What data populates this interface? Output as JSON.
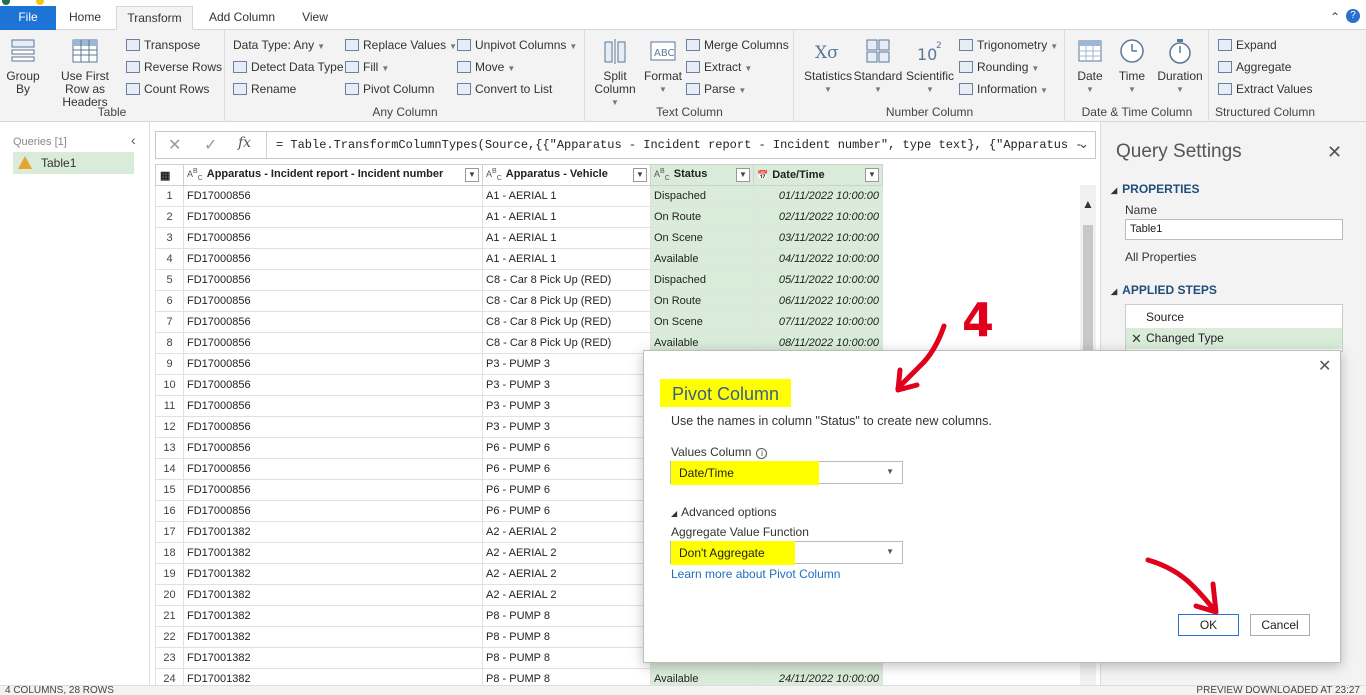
{
  "tabs": {
    "file": "File",
    "home": "Home",
    "transform": "Transform",
    "add_column": "Add Column",
    "view": "View"
  },
  "ribbon": {
    "table": {
      "label": "Table",
      "group_by": "Group By",
      "use_first_row": "Use First Row as Headers",
      "transpose": "Transpose",
      "reverse_rows": "Reverse Rows",
      "count_rows": "Count Rows"
    },
    "any_column": {
      "label": "Any Column",
      "data_type": "Data Type: Any",
      "detect_data_type": "Detect Data Type",
      "rename": "Rename",
      "replace_values": "Replace Values",
      "fill": "Fill",
      "pivot_column": "Pivot Column",
      "unpivot_columns": "Unpivot Columns",
      "move": "Move",
      "convert_to_list": "Convert to List"
    },
    "text_column": {
      "label": "Text Column",
      "split_column": "Split Column",
      "format": "Format",
      "merge_columns": "Merge Columns",
      "extract": "Extract",
      "parse": "Parse"
    },
    "number_column": {
      "label": "Number Column",
      "statistics": "Statistics",
      "standard": "Standard",
      "scientific": "Scientific",
      "trigonometry": "Trigonometry",
      "rounding": "Rounding",
      "information": "Information"
    },
    "date_time_column": {
      "label": "Date & Time Column",
      "date": "Date",
      "time": "Time",
      "duration": "Duration"
    },
    "structured_column": {
      "label": "Structured Column",
      "expand": "Expand",
      "aggregate": "Aggregate",
      "extract_values": "Extract Values"
    }
  },
  "queries": {
    "title": "Queries [1]",
    "items": [
      "Table1"
    ]
  },
  "formula_bar": {
    "cancel_glyph": "✕",
    "commit_glyph": "✓",
    "fx_glyph": "fx",
    "formula": "= Table.TransformColumnTypes(Source,{{\"Apparatus - Incident report - Incident number\", type text}, {\"Apparatus -"
  },
  "grid": {
    "columns": [
      {
        "type": "ABC",
        "name": "Apparatus - Incident report - Incident number"
      },
      {
        "type": "ABC",
        "name": "Apparatus - Vehicle"
      },
      {
        "type": "ABC",
        "name": "Status"
      },
      {
        "type": "cal",
        "name": "Date/Time"
      }
    ],
    "rows": [
      [
        "1",
        "FD17000856",
        "A1 - AERIAL 1",
        "Dispached",
        "01/11/2022 10:00:00"
      ],
      [
        "2",
        "FD17000856",
        "A1 - AERIAL 1",
        "On Route",
        "02/11/2022 10:00:00"
      ],
      [
        "3",
        "FD17000856",
        "A1 - AERIAL 1",
        "On Scene",
        "03/11/2022 10:00:00"
      ],
      [
        "4",
        "FD17000856",
        "A1 - AERIAL 1",
        "Available",
        "04/11/2022 10:00:00"
      ],
      [
        "5",
        "FD17000856",
        "C8 - Car 8 Pick Up (RED)",
        "Dispached",
        "05/11/2022 10:00:00"
      ],
      [
        "6",
        "FD17000856",
        "C8 - Car 8 Pick Up (RED)",
        "On Route",
        "06/11/2022 10:00:00"
      ],
      [
        "7",
        "FD17000856",
        "C8 - Car 8 Pick Up (RED)",
        "On Scene",
        "07/11/2022 10:00:00"
      ],
      [
        "8",
        "FD17000856",
        "C8 - Car 8 Pick Up (RED)",
        "Available",
        "08/11/2022 10:00:00"
      ],
      [
        "9",
        "FD17000856",
        "P3 - PUMP 3",
        "",
        ""
      ],
      [
        "10",
        "FD17000856",
        "P3 - PUMP 3",
        "",
        ""
      ],
      [
        "11",
        "FD17000856",
        "P3 - PUMP 3",
        "",
        ""
      ],
      [
        "12",
        "FD17000856",
        "P3 - PUMP 3",
        "",
        ""
      ],
      [
        "13",
        "FD17000856",
        "P6 - PUMP 6",
        "",
        ""
      ],
      [
        "14",
        "FD17000856",
        "P6 - PUMP 6",
        "",
        ""
      ],
      [
        "15",
        "FD17000856",
        "P6 - PUMP 6",
        "",
        ""
      ],
      [
        "16",
        "FD17000856",
        "P6 - PUMP 6",
        "",
        ""
      ],
      [
        "17",
        "FD17001382",
        "A2 - AERIAL 2",
        "",
        ""
      ],
      [
        "18",
        "FD17001382",
        "A2 - AERIAL 2",
        "",
        ""
      ],
      [
        "19",
        "FD17001382",
        "A2 - AERIAL 2",
        "",
        ""
      ],
      [
        "20",
        "FD17001382",
        "A2 - AERIAL 2",
        "",
        ""
      ],
      [
        "21",
        "FD17001382",
        "P8 - PUMP 8",
        "",
        ""
      ],
      [
        "22",
        "FD17001382",
        "P8 - PUMP 8",
        "",
        ""
      ],
      [
        "23",
        "FD17001382",
        "P8 - PUMP 8",
        "",
        ""
      ],
      [
        "24",
        "FD17001382",
        "P8 - PUMP 8",
        "Available",
        "24/11/2022 10:00:00"
      ]
    ]
  },
  "settings": {
    "title": "Query Settings",
    "properties_label": "PROPERTIES",
    "name_label": "Name",
    "name_value": "Table1",
    "all_properties": "All Properties",
    "applied_steps_label": "APPLIED STEPS",
    "steps": [
      "Source",
      "Changed Type"
    ]
  },
  "status": {
    "left": "4 COLUMNS, 28 ROWS",
    "right": "PREVIEW DOWNLOADED AT 23:27"
  },
  "dialog": {
    "title": "Pivot Column",
    "description": "Use the names in column \"Status\" to create new columns.",
    "values_column_label": "Values Column",
    "values_column_value": "Date/Time",
    "advanced_options": "Advanced options",
    "aggregate_label": "Aggregate Value Function",
    "aggregate_value": "Don't Aggregate",
    "learn_more": "Learn more about Pivot Column",
    "ok": "OK",
    "cancel": "Cancel"
  },
  "annotation": {
    "step_number": "4",
    "highlight_color": "#ffff00",
    "arrow_color": "#e0001b"
  },
  "colors": {
    "accent": "#1e73d6",
    "selected_column": "#d9ecd9",
    "heading_blue": "#1f4e79"
  }
}
